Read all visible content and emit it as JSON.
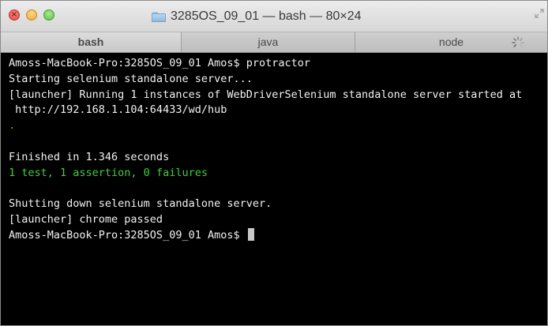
{
  "window": {
    "title": "3285OS_09_01 — bash — 80×24",
    "icons": {
      "close": "close-icon",
      "minimize": "minimize-icon",
      "zoom": "zoom-icon",
      "folder": "folder-icon",
      "fullscreen": "fullscreen-icon"
    }
  },
  "tabs": [
    {
      "label": "bash",
      "active": true
    },
    {
      "label": "java",
      "active": false
    },
    {
      "label": "node",
      "active": false,
      "busy": true
    }
  ],
  "terminal": {
    "lines": [
      {
        "text": "Amoss-MacBook-Pro:3285OS_09_01 Amos$ protractor",
        "color": "#f2f2f2"
      },
      {
        "text": "Starting selenium standalone server...",
        "color": "#f2f2f2"
      },
      {
        "text": "[launcher] Running 1 instances of WebDriverSelenium standalone server started at",
        "color": "#f2f2f2"
      },
      {
        "text": " http://192.168.1.104:64433/wd/hub",
        "color": "#f2f2f2"
      },
      {
        "text": ".",
        "color": "#3ecf3e"
      },
      {
        "text": "",
        "color": "#f2f2f2"
      },
      {
        "text": "Finished in 1.346 seconds",
        "color": "#f2f2f2"
      },
      {
        "text": "1 test, 1 assertion, 0 failures",
        "color": "#3ecf3e"
      },
      {
        "text": "",
        "color": "#f2f2f2"
      },
      {
        "text": "Shutting down selenium standalone server.",
        "color": "#f2f2f2"
      },
      {
        "text": "[launcher] chrome passed",
        "color": "#f2f2f2"
      },
      {
        "text": "Amoss-MacBook-Pro:3285OS_09_01 Amos$ ",
        "color": "#f2f2f2"
      }
    ]
  },
  "colors": {
    "background": "#000000",
    "text": "#f2f2f2",
    "success": "#3ecf3e"
  }
}
